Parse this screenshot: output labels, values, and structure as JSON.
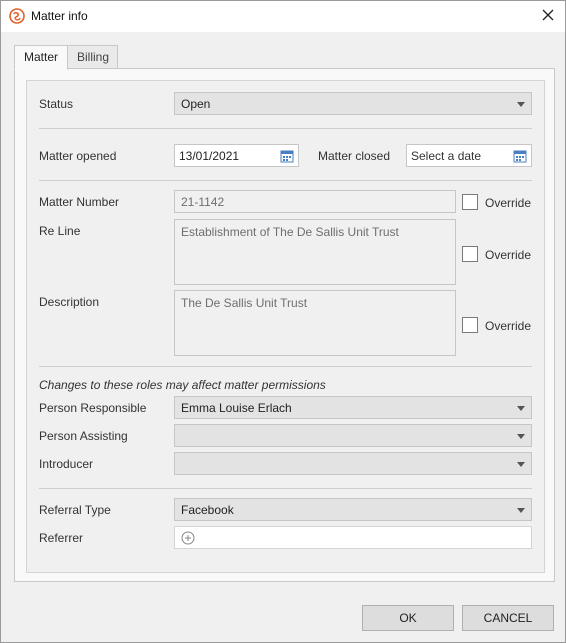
{
  "window": {
    "title": "Matter info",
    "app_icon": "smokeball-logo-icon",
    "close_icon": "close-icon"
  },
  "tabs": [
    {
      "label": "Matter",
      "active": true
    },
    {
      "label": "Billing",
      "active": false
    }
  ],
  "form": {
    "status": {
      "label": "Status",
      "value": "Open"
    },
    "matter_opened": {
      "label": "Matter opened",
      "value": "13/01/2021"
    },
    "matter_closed": {
      "label": "Matter closed",
      "placeholder": "Select a date"
    },
    "matter_number": {
      "label": "Matter Number",
      "value": "21-1142",
      "override_label": "Override",
      "override_checked": false
    },
    "re_line": {
      "label": "Re Line",
      "value": "Establishment of The De Sallis Unit Trust",
      "override_label": "Override",
      "override_checked": false
    },
    "description": {
      "label": "Description",
      "value": "The De Sallis Unit Trust",
      "override_label": "Override",
      "override_checked": false
    },
    "roles_note": "Changes to these roles may affect matter permissions",
    "person_responsible": {
      "label": "Person Responsible",
      "value": "Emma Louise Erlach"
    },
    "person_assisting": {
      "label": "Person Assisting",
      "value": ""
    },
    "introducer": {
      "label": "Introducer",
      "value": ""
    },
    "referral_type": {
      "label": "Referral Type",
      "value": "Facebook"
    },
    "referrer": {
      "label": "Referrer",
      "add_icon": "add-circle-icon"
    }
  },
  "buttons": {
    "ok": "OK",
    "cancel": "CANCEL"
  },
  "colors": {
    "accent_logo": "#e0622a",
    "calendar_icon": "#4a7fc1"
  }
}
